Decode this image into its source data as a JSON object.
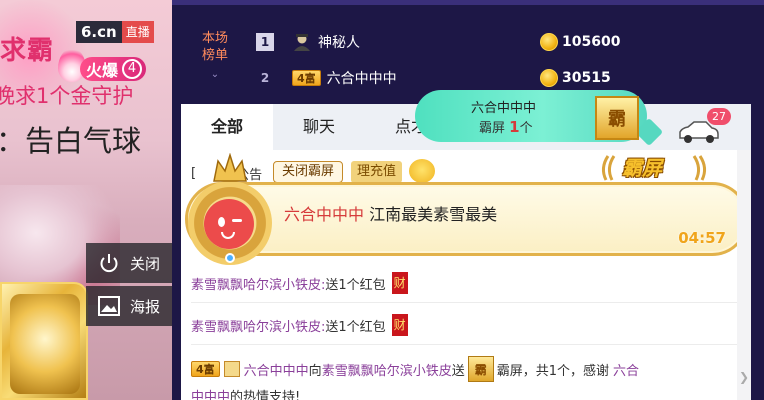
{
  "video": {
    "brand": "6.cn",
    "live_label": "直播",
    "hot_label": "火爆",
    "hot_rank": "4",
    "overlay_line1": "求霸",
    "overlay_line2": "晚求1个金守护",
    "overlay_line3": "：告白气球",
    "close_label": "关闭",
    "poster_label": "海报"
  },
  "ranking": {
    "tab_label": "本场\n榜单",
    "rows": [
      {
        "index": "1",
        "name": "神秘人",
        "level": "",
        "coins": "105600"
      },
      {
        "index": "2",
        "name": "六合中中中",
        "level": "4富",
        "coins": "30515"
      }
    ]
  },
  "tabs": [
    "全部",
    "聊天",
    "点才"
  ],
  "badge_card": {
    "name": "六合中中中",
    "label": "霸屏",
    "count": "1",
    "unit": "个",
    "icon_glyph": "霸"
  },
  "car_count": "27",
  "system": {
    "prefix": "[",
    "notice_fragment": "公告",
    "close_ba_label": "关闭霸屏",
    "recharge_label": "理充值"
  },
  "ba_banner": {
    "name": "六合中中中",
    "message": "江南最美素雪最美",
    "timer": "04:57",
    "badge_text": "霸屏"
  },
  "messages": [
    {
      "user": "素雪飘飘哈尔滨小铁皮:",
      "text": " 送1个红包",
      "gift": "财"
    },
    {
      "user": "素雪飘飘哈尔滨小铁皮:",
      "text": " 送1个红包",
      "gift": "财"
    }
  ],
  "thanks": {
    "level": "4富",
    "sender": "六合中中中",
    "to": " 向 ",
    "receiver": "素雪飘飘哈尔滨小铁皮",
    "send": " 送",
    "gift_glyph": "霸",
    "gift_text": "霸屏，共1个，感谢",
    "thank_name": "六合",
    "line2_name": "中中中",
    "line2_text": " 的热情支持!"
  },
  "colors": {
    "header_bg": "#1d1746",
    "accent_red": "#d63b3b",
    "user_purple": "#8a3f9a",
    "gold": "#f0a51c",
    "teal": "#56d8c0"
  }
}
